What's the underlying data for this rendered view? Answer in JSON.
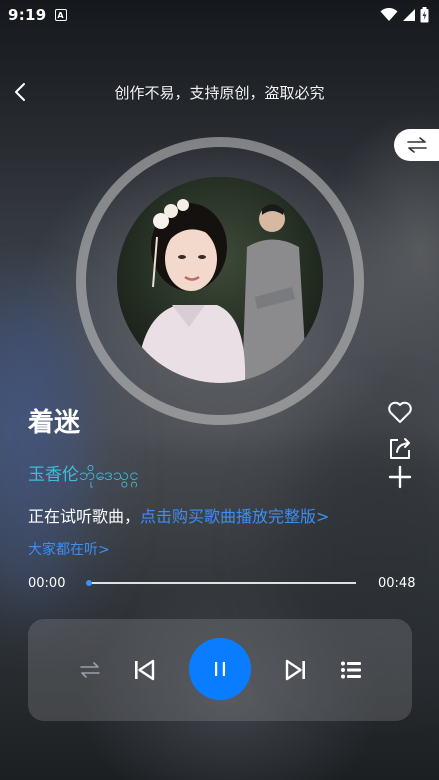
{
  "status_bar": {
    "time": "9:19",
    "sim_label": "A"
  },
  "header": {
    "title": "创作不易，支持原创，盗取必究"
  },
  "song": {
    "title": "着迷",
    "artist": "玉香伦ဘိုဒေသွင္ဂ",
    "notice_prefix": "正在试听歌曲，",
    "notice_link": "点击购买歌曲播放完整版>",
    "everyone_link": "大家都在听>"
  },
  "progress": {
    "current_time": "00:00",
    "total_time": "00:48",
    "fraction": 0.01
  },
  "colors": {
    "accent": "#0a7cff",
    "link": "#3b8ff5",
    "artist": "#3fbcd9"
  },
  "icons": {
    "back": "chevron-left-icon",
    "switch": "swap-arrows-icon",
    "like": "heart-icon",
    "share": "share-icon",
    "add": "plus-icon",
    "mode": "repeat-icon",
    "prev": "skip-previous-icon",
    "play": "pause-icon",
    "next": "skip-next-icon",
    "playlist": "playlist-icon"
  }
}
